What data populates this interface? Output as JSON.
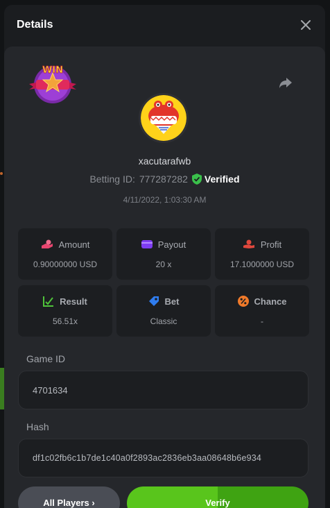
{
  "modal": {
    "title": "Details"
  },
  "player": {
    "username": "xacutarafwb",
    "betting_id_label": "Betting ID:",
    "betting_id": "777287282",
    "verified_label": "Verified",
    "timestamp": "4/11/2022, 1:03:30 AM",
    "badge_text": "WIN"
  },
  "stats": [
    {
      "label": "Amount",
      "value": "0.90000000 USD",
      "icon": "coins-hand-icon"
    },
    {
      "label": "Payout",
      "value": "20 x",
      "icon": "wallet-icon"
    },
    {
      "label": "Profit",
      "value": "17.1000000 USD",
      "icon": "hand-coin-icon"
    },
    {
      "label": "Result",
      "value": "56.51x",
      "icon": "chart-check-icon"
    },
    {
      "label": "Bet",
      "value": "Classic",
      "icon": "tag-icon"
    },
    {
      "label": "Chance",
      "value": "-",
      "icon": "percent-icon"
    }
  ],
  "game": {
    "id_label": "Game ID",
    "id_value": "4701634",
    "hash_label": "Hash",
    "hash_value": "df1c02fb6c1b7de1c40a0f2893ac2836eb3aa08648b6e934"
  },
  "buttons": {
    "all_players": "All Players ›",
    "verify": "Verify"
  },
  "colors": {
    "accent_green": "#59c51c",
    "verified_green": "#3ac04b",
    "amount_pink": "#e8456f",
    "payout_purple": "#7d3df0",
    "profit_red": "#e0483d",
    "result_green": "#4fc33a",
    "bet_blue": "#2f7df0",
    "chance_orange": "#f07a2a"
  }
}
